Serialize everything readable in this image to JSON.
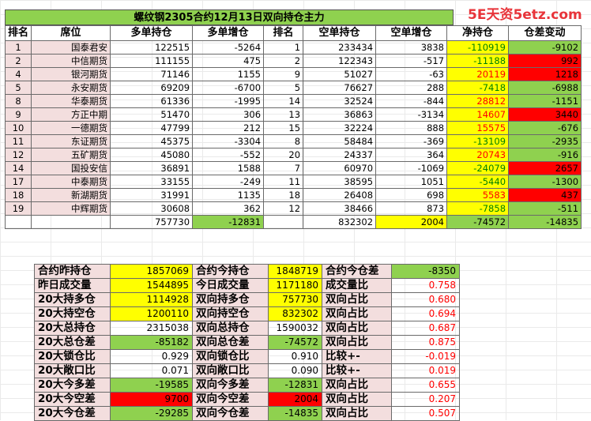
{
  "title": "螺纹钢2305合约12月13日双向持仓主力",
  "watermark": "5E天资5etz.com",
  "headers": [
    "排名",
    "席位",
    "多单持仓",
    "多单增仓",
    "排名",
    "空单持仓",
    "空单增仓",
    "净持仓",
    "仓差变动"
  ],
  "rows": [
    {
      "rank": "1",
      "seat": "国泰君安",
      "long": "122515",
      "long_chg": "-5264",
      "srank": "1",
      "short": "233434",
      "short_chg": "3838",
      "net": "-110919",
      "diff": "-9102",
      "net_bg": "yel",
      "net_color": "neg",
      "diff_bg": "grn"
    },
    {
      "rank": "2",
      "seat": "中信期货",
      "long": "111155",
      "long_chg": "475",
      "srank": "2",
      "short": "122343",
      "short_chg": "-517",
      "net": "-11188",
      "diff": "992",
      "net_bg": "yel",
      "net_color": "neg",
      "diff_bg": "red"
    },
    {
      "rank": "4",
      "seat": "银河期货",
      "long": "71146",
      "long_chg": "1155",
      "srank": "9",
      "short": "51027",
      "short_chg": "-63",
      "net": "20119",
      "diff": "1218",
      "net_bg": "yel",
      "net_color": "pos",
      "diff_bg": "red"
    },
    {
      "rank": "5",
      "seat": "永安期货",
      "long": "69209",
      "long_chg": "-6700",
      "srank": "5",
      "short": "76627",
      "short_chg": "288",
      "net": "-7418",
      "diff": "-6988",
      "net_bg": "yel",
      "net_color": "neg",
      "diff_bg": "grn"
    },
    {
      "rank": "8",
      "seat": "华泰期货",
      "long": "61336",
      "long_chg": "-1995",
      "srank": "14",
      "short": "32524",
      "short_chg": "-844",
      "net": "28812",
      "diff": "-1151",
      "net_bg": "yel",
      "net_color": "pos",
      "diff_bg": "grn"
    },
    {
      "rank": "9",
      "seat": "方正中期",
      "long": "51470",
      "long_chg": "306",
      "srank": "13",
      "short": "36863",
      "short_chg": "-3134",
      "net": "14607",
      "diff": "3440",
      "net_bg": "yel",
      "net_color": "pos",
      "diff_bg": "red"
    },
    {
      "rank": "10",
      "seat": "一德期货",
      "long": "47799",
      "long_chg": "212",
      "srank": "15",
      "short": "32224",
      "short_chg": "888",
      "net": "15575",
      "diff": "-676",
      "net_bg": "yel",
      "net_color": "pos",
      "diff_bg": "grn"
    },
    {
      "rank": "11",
      "seat": "东证期货",
      "long": "45375",
      "long_chg": "-3304",
      "srank": "8",
      "short": "58484",
      "short_chg": "-369",
      "net": "-13109",
      "diff": "-2935",
      "net_bg": "yel",
      "net_color": "neg",
      "diff_bg": "grn"
    },
    {
      "rank": "12",
      "seat": "五矿期货",
      "long": "45080",
      "long_chg": "-552",
      "srank": "20",
      "short": "24337",
      "short_chg": "364",
      "net": "20743",
      "diff": "-916",
      "net_bg": "yel",
      "net_color": "pos",
      "diff_bg": "grn"
    },
    {
      "rank": "14",
      "seat": "国投安信",
      "long": "36891",
      "long_chg": "1588",
      "srank": "7",
      "short": "60970",
      "short_chg": "-1069",
      "net": "-24079",
      "diff": "2657",
      "net_bg": "yel",
      "net_color": "neg",
      "diff_bg": "red"
    },
    {
      "rank": "17",
      "seat": "中泰期货",
      "long": "33155",
      "long_chg": "-249",
      "srank": "11",
      "short": "38595",
      "short_chg": "1051",
      "net": "-5440",
      "diff": "-1300",
      "net_bg": "yel",
      "net_color": "neg",
      "diff_bg": "grn"
    },
    {
      "rank": "18",
      "seat": "新湖期货",
      "long": "31991",
      "long_chg": "1135",
      "srank": "18",
      "short": "26408",
      "short_chg": "698",
      "net": "5583",
      "diff": "437",
      "net_bg": "yel",
      "net_color": "pos",
      "diff_bg": "red"
    },
    {
      "rank": "19",
      "seat": "中辉期货",
      "long": "30608",
      "long_chg": "362",
      "srank": "12",
      "short": "38466",
      "short_chg": "873",
      "net": "-7858",
      "diff": "-511",
      "net_bg": "yel",
      "net_color": "neg",
      "diff_bg": "grn"
    }
  ],
  "totals": {
    "long": "757730",
    "long_chg": "-12831",
    "short": "832302",
    "short_chg": "2004",
    "net": "-74572",
    "diff": "-14835"
  },
  "summary": [
    {
      "l1": "合约昨持仓",
      "v1": "1857069",
      "b1": "yel",
      "l2": "合约今持仓",
      "v2": "1848719",
      "b2": "yel",
      "l3": "合约今仓差",
      "v3": "-8350",
      "b3": "grn",
      "c3": ""
    },
    {
      "l1": "昨日成交量",
      "v1": "1544895",
      "b1": "yel",
      "l2": "今日成交量",
      "v2": "1171180",
      "b2": "yel",
      "l3": "成交量比",
      "v3": "0.758",
      "b3": "",
      "c3": "rt"
    },
    {
      "l1": "20大持多仓",
      "v1": "1114928",
      "b1": "yel",
      "l2": "双向持多仓",
      "v2": "757730",
      "b2": "yel",
      "l3": "双向占比",
      "v3": "0.680",
      "b3": "",
      "c3": "rt"
    },
    {
      "l1": "20大持空仓",
      "v1": "1200110",
      "b1": "yel",
      "l2": "双向持空仓",
      "v2": "832302",
      "b2": "yel",
      "l3": "双向占比",
      "v3": "0.694",
      "b3": "",
      "c3": "rt"
    },
    {
      "l1": "20大总持仓",
      "v1": "2315038",
      "b1": "",
      "l2": "双向总持仓",
      "v2": "1590032",
      "b2": "",
      "l3": "双向占比",
      "v3": "0.687",
      "b3": "",
      "c3": "rt"
    },
    {
      "l1": "20大总仓差",
      "v1": "-85182",
      "b1": "grn",
      "l2": "双向总仓差",
      "v2": "-74572",
      "b2": "grn",
      "l3": "双向占比",
      "v3": "0.875",
      "b3": "",
      "c3": "rt"
    },
    {
      "l1": "20大锁仓比",
      "v1": "0.929",
      "b1": "",
      "l2": "双向锁仓比",
      "v2": "0.910",
      "b2": "",
      "l3": "比较+-",
      "v3": "-0.019",
      "b3": "",
      "c3": "rt"
    },
    {
      "l1": "20大敞口比",
      "v1": "0.071",
      "b1": "",
      "l2": "双向敞口比",
      "v2": "0.090",
      "b2": "",
      "l3": "比较+-",
      "v3": "0.019",
      "b3": "",
      "c3": "rt"
    },
    {
      "l1": "20大今多差",
      "v1": "-19585",
      "b1": "grn",
      "l2": "双向今多差",
      "v2": "-12831",
      "b2": "grn",
      "l3": "双向占比",
      "v3": "0.655",
      "b3": "",
      "c3": "rt"
    },
    {
      "l1": "20大今空差",
      "v1": "9700",
      "b1": "red",
      "l2": "双向今空差",
      "v2": "2004",
      "b2": "red",
      "l3": "双向占比",
      "v3": "0.207",
      "b3": "",
      "c3": "rt"
    },
    {
      "l1": "20大今仓差",
      "v1": "-29285",
      "b1": "grn",
      "l2": "双向今仓差",
      "v2": "-14835",
      "b2": "grn",
      "l3": "双向占比",
      "v3": "0.507",
      "b3": "",
      "c3": "rt"
    }
  ]
}
